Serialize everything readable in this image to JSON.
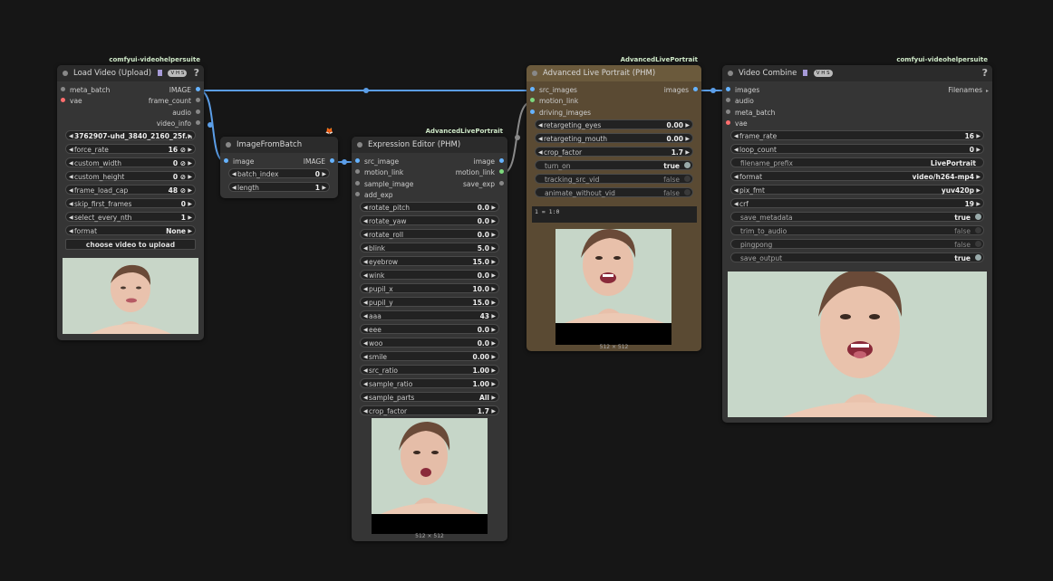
{
  "colors": {
    "link_blue": "#5b9ee8",
    "link_grey": "#8a8a8a",
    "port_blue": "#66b3ff",
    "port_red": "#ff6e6e",
    "port_grey": "#888",
    "port_green": "#7dd87d"
  },
  "badges": {
    "vhs_load": "comfyui-videohelpersuite",
    "vhs_combine": "comfyui-videohelpersuite",
    "live_editor": "AdvancedLivePortrait",
    "live_main": "AdvancedLivePortrait",
    "batch": "🦊"
  },
  "load_video": {
    "title": "Load Video (Upload)",
    "vhs": "V H S",
    "help": "?",
    "inputs": [
      "meta_batch",
      "vae"
    ],
    "outputs": [
      "IMAGE",
      "frame_count",
      "audio",
      "video_info"
    ],
    "widgets": [
      {
        "label": "3762907-uhd_3840_2160_25f...",
        "value": ""
      },
      {
        "label": "force_rate",
        "value": "16 ⊘"
      },
      {
        "label": "custom_width",
        "value": "0 ⊘"
      },
      {
        "label": "custom_height",
        "value": "0 ⊘"
      },
      {
        "label": "frame_load_cap",
        "value": "48 ⊘"
      },
      {
        "label": "skip_first_frames",
        "value": "0"
      },
      {
        "label": "select_every_nth",
        "value": "1"
      },
      {
        "label": "format",
        "value": "None"
      }
    ],
    "upload_button": "choose video to upload"
  },
  "image_from_batch": {
    "title": "ImageFromBatch",
    "inputs": [
      "image"
    ],
    "outputs": [
      "IMAGE"
    ],
    "widgets": [
      {
        "label": "batch_index",
        "value": "0"
      },
      {
        "label": "length",
        "value": "1"
      }
    ]
  },
  "expression_editor": {
    "title": "Expression Editor (PHM)",
    "inputs": [
      "src_image",
      "motion_link",
      "sample_image",
      "add_exp"
    ],
    "outputs": [
      "image",
      "motion_link",
      "save_exp"
    ],
    "widgets": [
      {
        "label": "rotate_pitch",
        "value": "0.0"
      },
      {
        "label": "rotate_yaw",
        "value": "0.0"
      },
      {
        "label": "rotate_roll",
        "value": "0.0"
      },
      {
        "label": "blink",
        "value": "5.0"
      },
      {
        "label": "eyebrow",
        "value": "15.0"
      },
      {
        "label": "wink",
        "value": "0.0"
      },
      {
        "label": "pupil_x",
        "value": "10.0"
      },
      {
        "label": "pupil_y",
        "value": "15.0"
      },
      {
        "label": "aaa",
        "value": "43"
      },
      {
        "label": "eee",
        "value": "0.0"
      },
      {
        "label": "woo",
        "value": "0.0"
      },
      {
        "label": "smile",
        "value": "0.00"
      },
      {
        "label": "src_ratio",
        "value": "1.00"
      },
      {
        "label": "sample_ratio",
        "value": "1.00"
      },
      {
        "label": "sample_parts",
        "value": "All"
      },
      {
        "label": "crop_factor",
        "value": "1.7"
      }
    ],
    "preview_size": "512 × 512"
  },
  "live_portrait": {
    "title": "Advanced Live Portrait (PHM)",
    "inputs": [
      "src_images",
      "motion_link",
      "driving_images"
    ],
    "outputs": [
      "images"
    ],
    "widgets": [
      {
        "label": "retargeting_eyes",
        "value": "0.00"
      },
      {
        "label": "retargeting_mouth",
        "value": "0.00"
      },
      {
        "label": "crop_factor",
        "value": "1.7"
      }
    ],
    "toggles": [
      {
        "label": "turn_on",
        "value": "true",
        "on": true
      },
      {
        "label": "tracking_src_vid",
        "value": "false",
        "on": false
      },
      {
        "label": "animate_without_vid",
        "value": "false",
        "on": false
      }
    ],
    "command_text": "1 = 1:0",
    "preview_size": "512 × 512"
  },
  "video_combine": {
    "title": "Video Combine",
    "vhs": "V H S",
    "help": "?",
    "inputs": [
      "images",
      "audio",
      "meta_batch",
      "vae"
    ],
    "outputs": [
      "Filenames"
    ],
    "widgets": [
      {
        "label": "frame_rate",
        "value": "16"
      },
      {
        "label": "loop_count",
        "value": "0"
      }
    ],
    "text_widgets": [
      {
        "label": "filename_prefix",
        "value": "LivePortrait"
      },
      {
        "label": "format",
        "value": "video/h264-mp4"
      },
      {
        "label": "pix_fmt",
        "value": "yuv420p"
      },
      {
        "label": "crf",
        "value": "19"
      }
    ],
    "toggles": [
      {
        "label": "save_metadata",
        "value": "true",
        "on": true
      },
      {
        "label": "trim_to_audio",
        "value": "false",
        "on": false
      },
      {
        "label": "pingpong",
        "value": "false",
        "on": false
      },
      {
        "label": "save_output",
        "value": "true",
        "on": true
      }
    ]
  }
}
